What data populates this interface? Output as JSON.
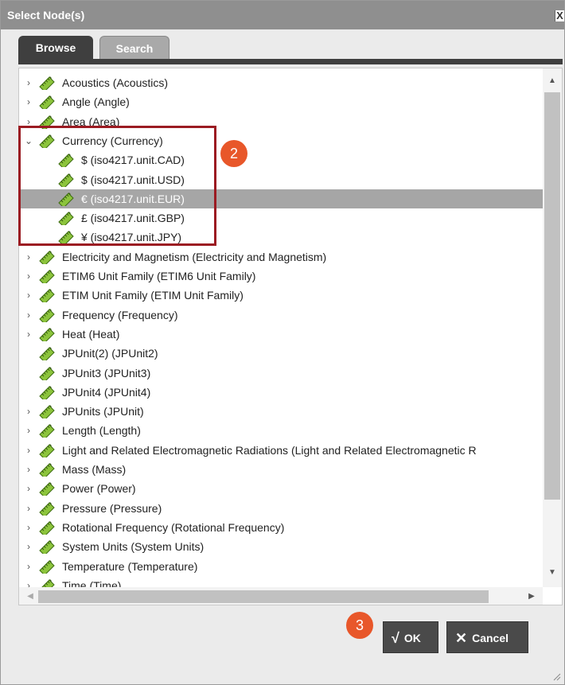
{
  "dialog": {
    "title": "Select Node(s)",
    "close_glyph": "X"
  },
  "tabs": [
    {
      "label": "Browse",
      "active": true
    },
    {
      "label": "Search",
      "active": false
    }
  ],
  "tree": {
    "rows": [
      {
        "label": "Acoustics (Acoustics)",
        "level": 0,
        "expandable": true,
        "expanded": false
      },
      {
        "label": "Angle (Angle)",
        "level": 0,
        "expandable": true,
        "expanded": false
      },
      {
        "label": "Area (Area)",
        "level": 0,
        "expandable": true,
        "expanded": false
      },
      {
        "label": "Currency (Currency)",
        "level": 0,
        "expandable": true,
        "expanded": true
      },
      {
        "label": "$ (iso4217.unit.CAD)",
        "level": 1,
        "expandable": false
      },
      {
        "label": "$ (iso4217.unit.USD)",
        "level": 1,
        "expandable": false
      },
      {
        "label": "€ (iso4217.unit.EUR)",
        "level": 1,
        "expandable": false,
        "selected": true
      },
      {
        "label": "£ (iso4217.unit.GBP)",
        "level": 1,
        "expandable": false
      },
      {
        "label": "¥ (iso4217.unit.JPY)",
        "level": 1,
        "expandable": false
      },
      {
        "label": "Electricity and Magnetism (Electricity and Magnetism)",
        "level": 0,
        "expandable": true,
        "expanded": false
      },
      {
        "label": "ETIM6 Unit Family (ETIM6 Unit Family)",
        "level": 0,
        "expandable": true,
        "expanded": false
      },
      {
        "label": "ETIM Unit Family (ETIM Unit Family)",
        "level": 0,
        "expandable": true,
        "expanded": false
      },
      {
        "label": "Frequency (Frequency)",
        "level": 0,
        "expandable": true,
        "expanded": false
      },
      {
        "label": "Heat (Heat)",
        "level": 0,
        "expandable": true,
        "expanded": false
      },
      {
        "label": "JPUnit(2) (JPUnit2)",
        "level": 0,
        "expandable": false
      },
      {
        "label": "JPUnit3 (JPUnit3)",
        "level": 0,
        "expandable": false
      },
      {
        "label": "JPUnit4 (JPUnit4)",
        "level": 0,
        "expandable": false
      },
      {
        "label": "JPUnits (JPUnit)",
        "level": 0,
        "expandable": true,
        "expanded": false
      },
      {
        "label": "Length (Length)",
        "level": 0,
        "expandable": true,
        "expanded": false
      },
      {
        "label": "Light and Related Electromagnetic Radiations (Light and Related Electromagnetic R",
        "level": 0,
        "expandable": true,
        "expanded": false
      },
      {
        "label": "Mass (Mass)",
        "level": 0,
        "expandable": true,
        "expanded": false
      },
      {
        "label": "Power (Power)",
        "level": 0,
        "expandable": true,
        "expanded": false
      },
      {
        "label": "Pressure (Pressure)",
        "level": 0,
        "expandable": true,
        "expanded": false
      },
      {
        "label": "Rotational Frequency (Rotational Frequency)",
        "level": 0,
        "expandable": true,
        "expanded": false
      },
      {
        "label": "System Units (System Units)",
        "level": 0,
        "expandable": true,
        "expanded": false
      },
      {
        "label": "Temperature (Temperature)",
        "level": 0,
        "expandable": true,
        "expanded": false
      },
      {
        "label": "Time (Time)",
        "level": 0,
        "expandable": true,
        "expanded": false
      }
    ]
  },
  "callouts": {
    "step2": "2",
    "step3": "3"
  },
  "buttons": {
    "ok_label": "OK",
    "cancel_label": "Cancel",
    "ok_glyph": "√",
    "cancel_glyph": "✕"
  },
  "colors": {
    "titlebar": "#8f8f8f",
    "selected_row": "#a6a6a6",
    "highlight_box": "#9b1b22",
    "callout_badge": "#e8572a",
    "button": "#4a4a4a"
  }
}
